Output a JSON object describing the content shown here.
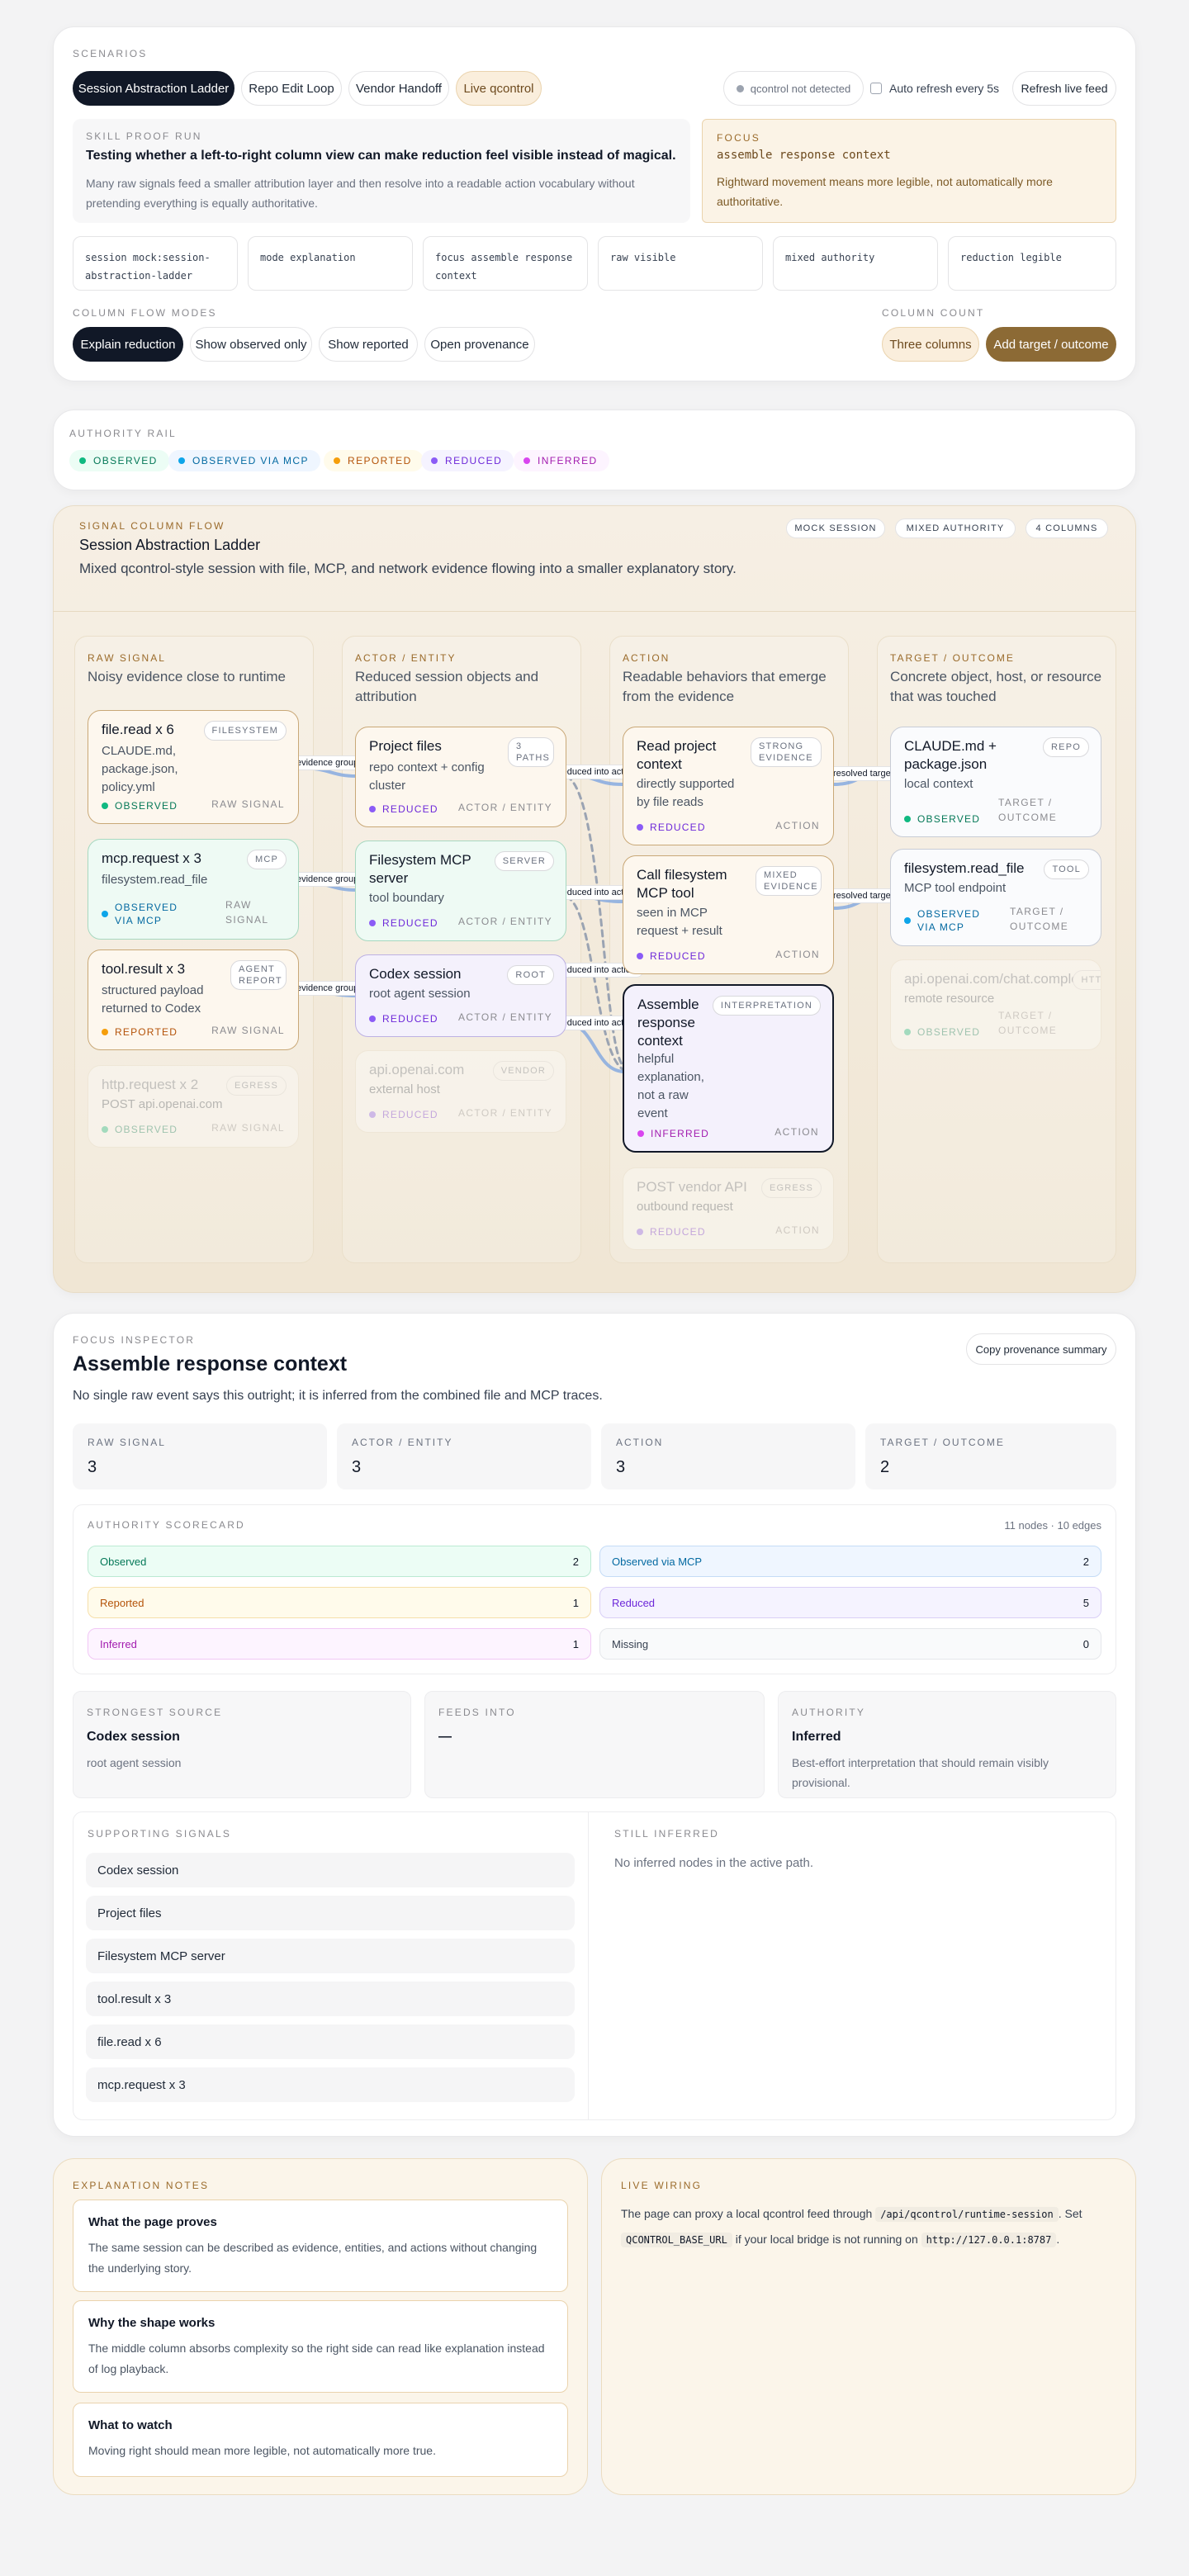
{
  "scenarios": {
    "eyebrow": "SCENARIOS",
    "tabs": [
      "Session Abstraction Ladder",
      "Repo Edit Loop",
      "Vendor Handoff",
      "Live qcontrol"
    ],
    "status": "qcontrol not detected",
    "auto_refresh": "Auto refresh every 5s",
    "refresh_btn": "Refresh live feed"
  },
  "proof": {
    "eyebrow": "SKILL PROOF RUN",
    "title": "Testing whether a left-to-right column view can make reduction feel visible instead of magical.",
    "desc": "Many raw signals feed a smaller attribution layer and then resolve into a readable action vocabulary without pretending everything is equally authoritative."
  },
  "focus": {
    "eyebrow": "FOCUS",
    "value": "assemble response context",
    "desc": "Rightward movement means more legible, not automatically more authoritative."
  },
  "crumbs": [
    "session mock:session-abstraction-ladder",
    "mode explanation",
    "focus assemble response context",
    "raw visible",
    "mixed authority",
    "reduction legible"
  ],
  "modes": {
    "eyebrow": "COLUMN FLOW MODES",
    "items": [
      "Explain reduction",
      "Show observed only",
      "Show reported",
      "Open provenance"
    ],
    "count_eyebrow": "COLUMN COUNT",
    "count_items": [
      "Three columns",
      "Add target / outcome"
    ]
  },
  "rail": {
    "eyebrow": "AUTHORITY RAIL",
    "items": [
      "OBSERVED",
      "OBSERVED VIA MCP",
      "REPORTED",
      "REDUCED",
      "INFERRED"
    ]
  },
  "colors": {
    "observed": "#10b981",
    "mcp": "#0ea5e9",
    "reported": "#f59e0b",
    "reduced": "#8b5cf6",
    "inferred": "#d946ef"
  },
  "flow": {
    "eyebrow": "SIGNAL COLUMN FLOW",
    "title": "Session Abstraction Ladder",
    "desc": "Mixed qcontrol-style session with file, MCP, and network evidence flowing into a smaller explanatory story.",
    "badges": [
      "MOCK SESSION",
      "MIXED AUTHORITY",
      "4 COLUMNS"
    ],
    "columns": [
      {
        "head": "RAW SIGNAL",
        "title": "Noisy evidence close to runtime"
      },
      {
        "head": "ACTOR / ENTITY",
        "title": "Reduced session objects and attribution"
      },
      {
        "head": "ACTION",
        "title": "Readable behaviors that emerge from the evidence"
      },
      {
        "head": "TARGET / OUTCOME",
        "title": "Concrete object, host, or resource that was touched"
      }
    ],
    "nodes": {
      "r1": {
        "title": "file.read x 6",
        "sub": "CLAUDE.md, package.json, policy.yml",
        "tag": "FILESYSTEM",
        "auth": "OBSERVED",
        "layer": "RAW SIGNAL"
      },
      "r2": {
        "title": "mcp.request x 3",
        "sub": "filesystem.read_file",
        "tag": "MCP",
        "auth": "OBSERVED VIA MCP",
        "layer": "RAW SIGNAL"
      },
      "r3": {
        "title": "tool.result x 3",
        "sub": "structured payload returned to Codex",
        "tag": "AGENT REPORT",
        "auth": "REPORTED",
        "layer": "RAW SIGNAL"
      },
      "r4": {
        "title": "http.request x 2",
        "sub": "POST api.openai.com",
        "tag": "EGRESS",
        "auth": "OBSERVED",
        "layer": "RAW SIGNAL"
      },
      "a1": {
        "title": "Project files",
        "sub": "repo context + config cluster",
        "tag": "3 PATHS",
        "auth": "REDUCED",
        "layer": "ACTOR / ENTITY"
      },
      "a2": {
        "title": "Filesystem MCP server",
        "sub": "tool boundary",
        "tag": "SERVER",
        "auth": "REDUCED",
        "layer": "ACTOR / ENTITY"
      },
      "a3": {
        "title": "Codex session",
        "sub": "root agent session",
        "tag": "ROOT",
        "auth": "REDUCED",
        "layer": "ACTOR / ENTITY"
      },
      "a4": {
        "title": "api.openai.com",
        "sub": "external host",
        "tag": "VENDOR",
        "auth": "REDUCED",
        "layer": "ACTOR / ENTITY"
      },
      "x1": {
        "title": "Read project context",
        "sub": "directly supported by file reads",
        "tag": "STRONG EVIDENCE",
        "auth": "REDUCED",
        "layer": "ACTION"
      },
      "x2": {
        "title": "Call filesystem MCP tool",
        "sub": "seen in MCP request + result",
        "tag": "MIXED EVIDENCE",
        "auth": "REDUCED",
        "layer": "ACTION"
      },
      "x3": {
        "title": "Assemble response context",
        "sub": "helpful explanation, not a raw event",
        "tag": "INTERPRETATION",
        "auth": "INFERRED",
        "layer": "ACTION"
      },
      "x4": {
        "title": "POST vendor API",
        "sub": "outbound request",
        "tag": "EGRESS",
        "auth": "REDUCED",
        "layer": "ACTION"
      },
      "t1": {
        "title": "CLAUDE.md + package.json",
        "sub": "local context",
        "tag": "REPO",
        "auth": "OBSERVED",
        "layer": "TARGET / OUTCOME"
      },
      "t2": {
        "title": "filesystem.read_file",
        "sub": "MCP tool endpoint",
        "tag": "TOOL",
        "auth": "OBSERVED VIA MCP",
        "layer": "TARGET / OUTCOME"
      },
      "t3": {
        "title": "api.openai.com/chat.completions",
        "sub": "remote resource",
        "tag": "HTTP",
        "auth": "OBSERVED",
        "layer": "TARGET / OUTCOME"
      }
    },
    "edge_labels": {
      "grouped": "evidence grouped",
      "reduced": "reduced into action",
      "resolved": "resolved target"
    }
  },
  "inspector": {
    "eyebrow": "FOCUS INSPECTOR",
    "title": "Assemble response context",
    "desc": "No single raw event says this outright; it is inferred from the combined file and MCP traces.",
    "copy_btn": "Copy provenance summary",
    "stats": [
      {
        "label": "RAW SIGNAL",
        "value": "3"
      },
      {
        "label": "ACTOR / ENTITY",
        "value": "3"
      },
      {
        "label": "ACTION",
        "value": "3"
      },
      {
        "label": "TARGET / OUTCOME",
        "value": "2"
      }
    ],
    "score_eyebrow": "AUTHORITY SCORECARD",
    "score_meta": "11 nodes · 10 edges",
    "scores": [
      {
        "label": "Observed",
        "value": "2"
      },
      {
        "label": "Observed via MCP",
        "value": "2"
      },
      {
        "label": "Reported",
        "value": "1"
      },
      {
        "label": "Reduced",
        "value": "5"
      },
      {
        "label": "Inferred",
        "value": "1"
      },
      {
        "label": "Missing",
        "value": "0"
      }
    ],
    "boxes": [
      {
        "label": "STRONGEST SOURCE",
        "title": "Codex session",
        "desc": "root agent session"
      },
      {
        "label": "FEEDS INTO",
        "title": "—",
        "desc": ""
      },
      {
        "label": "AUTHORITY",
        "title": "Inferred",
        "desc": "Best-effort interpretation that should remain visibly provisional."
      }
    ],
    "supporting_eyebrow": "SUPPORTING SIGNALS",
    "supporting": [
      "Codex session",
      "Project files",
      "Filesystem MCP server",
      "tool.result x 3",
      "file.read x 6",
      "mcp.request x 3"
    ],
    "inferred_eyebrow": "STILL INFERRED",
    "inferred_empty": "No inferred nodes in the active path."
  },
  "notes": {
    "eyebrow": "EXPLANATION NOTES",
    "items": [
      {
        "title": "What the page proves",
        "desc": "The same session can be described as evidence, entities, and actions without changing the underlying story."
      },
      {
        "title": "Why the shape works",
        "desc": "The middle column absorbs complexity so the right side can read like explanation instead of log playback."
      },
      {
        "title": "What to watch",
        "desc": "Moving right should mean more legible, not automatically more true."
      }
    ]
  },
  "wiring": {
    "eyebrow": "LIVE WIRING",
    "t1": "The page can proxy a local qcontrol feed through",
    "c1": "/api/qcontrol/runtime-session",
    "t2": ". Set",
    "c2": "QCONTROL_BASE_URL",
    "t3": "if your local bridge is not running on",
    "c3": "http://127.0.0.1:8787",
    "t4": "."
  }
}
